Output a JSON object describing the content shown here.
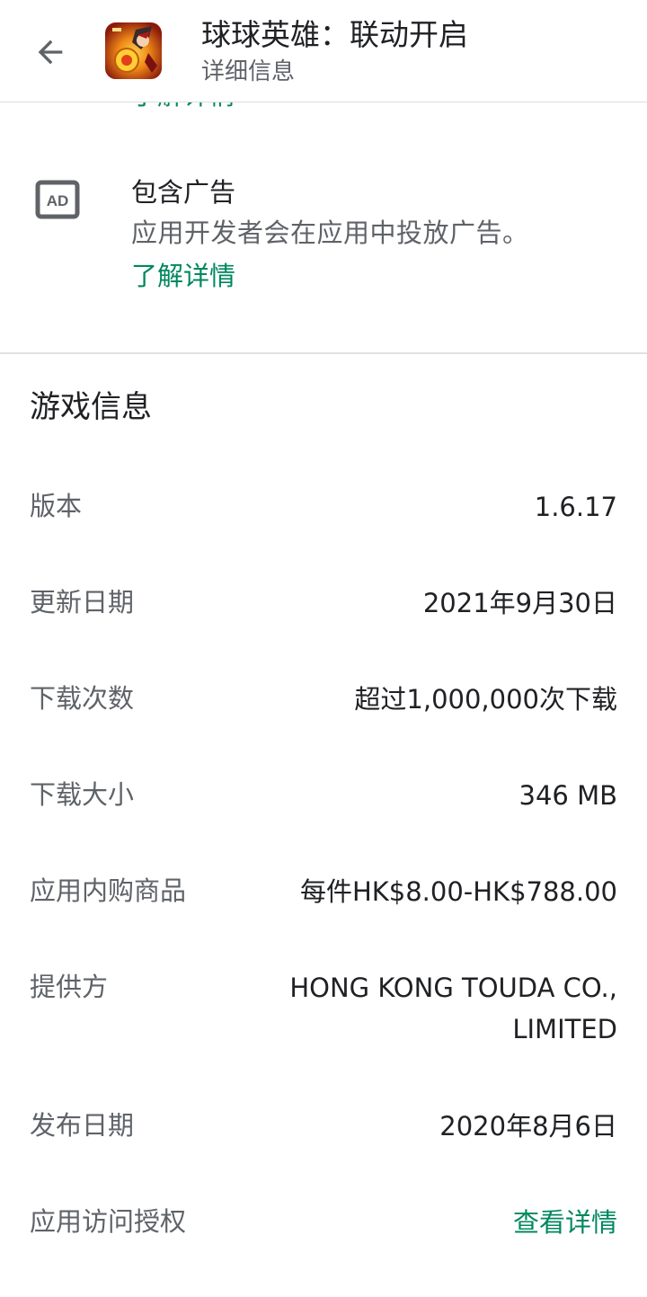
{
  "appbar": {
    "title": "球球英雄：联动开启",
    "subtitle": "详细信息"
  },
  "scroll_remnant_text": "了解详情",
  "ads": {
    "title": "包含广告",
    "description": "应用开发者会在应用中投放广告。",
    "learn_more": "了解详情",
    "icon_text": "AD"
  },
  "game_info": {
    "title": "游戏信息",
    "rows": [
      {
        "label": "版本",
        "value": "1.6.17"
      },
      {
        "label": "更新日期",
        "value": "2021年9月30日"
      },
      {
        "label": "下载次数",
        "value": "超过1,000,000次下载"
      },
      {
        "label": "下载大小",
        "value": "346 MB"
      },
      {
        "label": "应用内购商品",
        "value": "每件HK$8.00-HK$788.00"
      },
      {
        "label": "提供方",
        "value": "HONG KONG TOUDA CO., LIMITED"
      },
      {
        "label": "发布日期",
        "value": "2020年8月6日"
      },
      {
        "label": "应用访问授权",
        "value": "查看详情"
      }
    ]
  },
  "colors": {
    "accent_green": "#01875f",
    "text_primary": "#202124",
    "text_secondary": "#5f6368"
  }
}
